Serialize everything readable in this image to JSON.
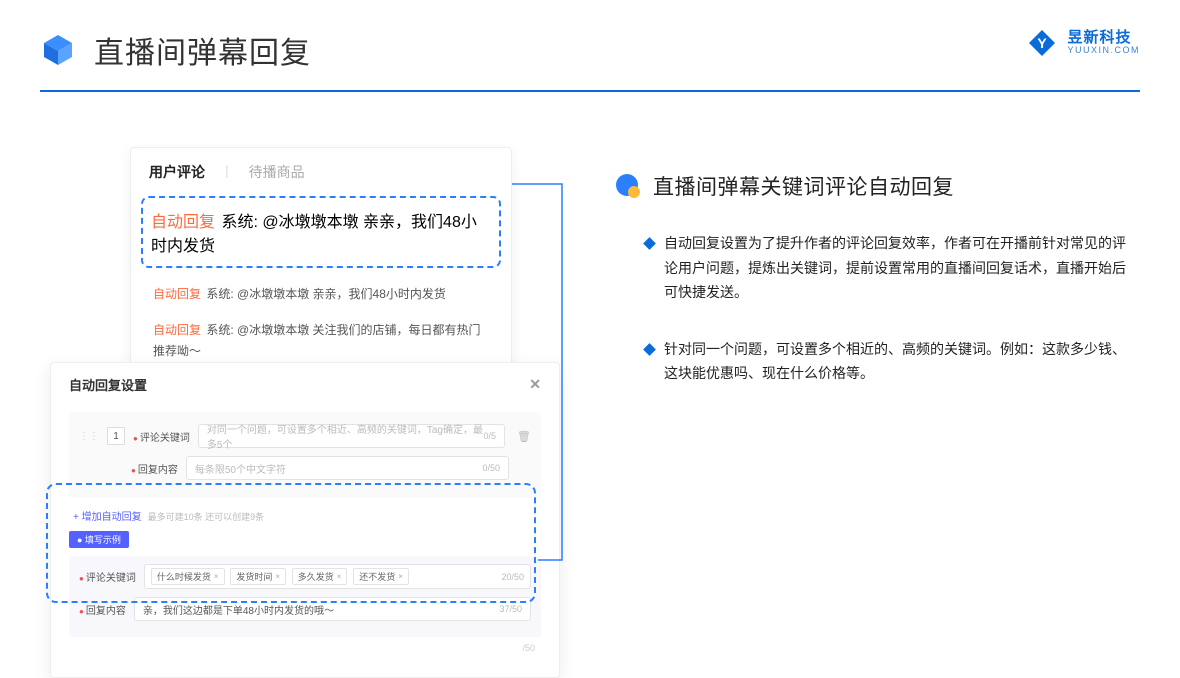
{
  "header": {
    "title": "直播间弹幕回复"
  },
  "brand": {
    "cn": "昱新科技",
    "en": "YUUXIN.COM"
  },
  "comments": {
    "tab_active": "用户评论",
    "tab_inactive": "待播商品",
    "row1_tag": "自动回复",
    "row1_text": "系统: @冰墩墩本墩 亲亲，我们48小时内发货",
    "row2_tag": "自动回复",
    "row2_text": "系统: @冰墩墩本墩 亲亲，我们48小时内发货",
    "row3_tag": "自动回复",
    "row3_text": "系统: @冰墩墩本墩 关注我们的店铺，每日都有热门推荐呦～"
  },
  "settings": {
    "title": "自动回复设置",
    "idx": "1",
    "label_keywords": "评论关键词",
    "placeholder_keywords": "对同一个问题，可设置多个相近、高频的关键词，Tag确定，最多5个",
    "counter_keywords": "0/5",
    "label_content": "回复内容",
    "placeholder_content": "每条限50个中文字符",
    "counter_content": "0/50",
    "add_link": "+ 增加自动回复",
    "add_hint": "最多可建10条 还可以创建9条",
    "example_badge": "● 填写示例",
    "ex_label_keywords": "评论关键词",
    "ex_chip1": "什么时候发货",
    "ex_chip2": "发货时间",
    "ex_chip3": "多久发货",
    "ex_chip4": "还不发货",
    "ex_counter_keywords": "20/50",
    "ex_label_content": "回复内容",
    "ex_content_value": "亲，我们这边都是下单48小时内发货的哦～",
    "ex_counter_content": "37/50",
    "ex_bottom_counter": "/50"
  },
  "right": {
    "section_title": "直播间弹幕关键词评论自动回复",
    "bullet1": "自动回复设置为了提升作者的评论回复效率，作者可在开播前针对常见的评论用户问题，提炼出关键词，提前设置常用的直播间回复话术，直播开始后可快捷发送。",
    "bullet2": "针对同一个问题，可设置多个相近的、高频的关键词。例如：这款多少钱、这块能优惠吗、现在什么价格等。"
  }
}
